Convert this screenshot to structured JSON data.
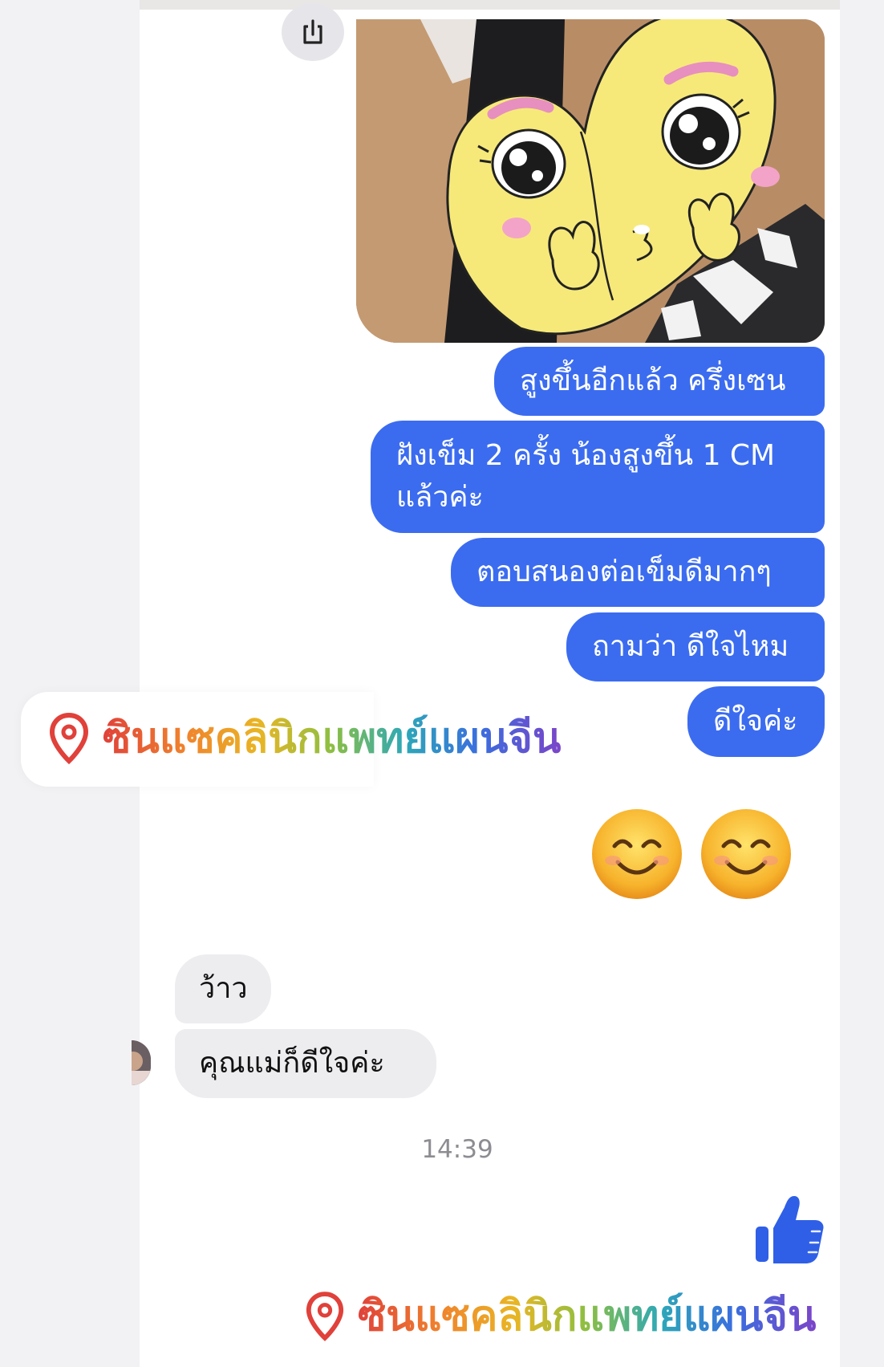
{
  "messages_out": [
    "สูงขึ้นอีกแล้ว ครึ่งเซน",
    "ฝังเข็ม 2 ครั้ง น้องสูงขึ้น 1 CM แล้วค่ะ",
    "ตอบสนองต่อเข็มดีมากๆ",
    "ถามว่า ดีใจไหม",
    "ดีใจค่ะ"
  ],
  "messages_in": [
    "ว้าว",
    "คุณแม่ก็ดีใจค่ะ"
  ],
  "timestamp": "14:39",
  "watermark": {
    "text": "ซินแซคลินิกแพทย์แผนจีน"
  },
  "icons": {
    "share": "share-icon",
    "emoji": "smiling-face-with-smiling-eyes",
    "like": "thumbs-up-icon",
    "location": "location-pin-icon"
  },
  "colors": {
    "outgoing_bubble": "#3b6cf0",
    "incoming_bubble": "#ededf0",
    "like": "#2f5fe6",
    "pin": "#e0413a"
  }
}
